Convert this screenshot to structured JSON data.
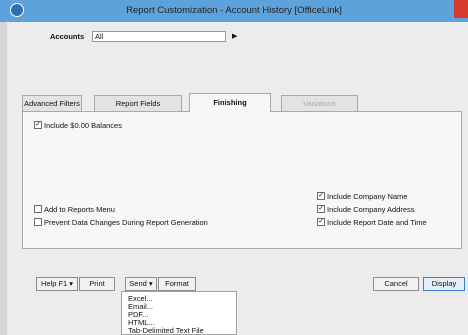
{
  "window": {
    "title": "Report Customization - Account History [OfficeLink]"
  },
  "accounts": {
    "label": "Accounts",
    "value": "All"
  },
  "tabs": [
    {
      "label": "Advanced Filters"
    },
    {
      "label": "Report Fields"
    },
    {
      "label": "Finishing"
    },
    {
      "label": "Variations"
    }
  ],
  "finishing": {
    "include_zero": {
      "label": "Include $0.00 Balances",
      "checked": true
    },
    "add_menu": {
      "label": "Add to Reports Menu",
      "checked": false
    },
    "prevent_changes": {
      "label": "Prevent Data Changes During Report Generation",
      "checked": false
    },
    "company_name": {
      "label": "Include Company Name",
      "checked": true
    },
    "company_address": {
      "label": "Include Company Address",
      "checked": true
    },
    "date_time": {
      "label": "Include Report Date and Time",
      "checked": true
    }
  },
  "buttons": {
    "help": "Help F1",
    "print": "Print",
    "send": "Send",
    "format": "Format",
    "cancel": "Cancel",
    "display": "Display"
  },
  "send_menu": [
    "Excel...",
    "Email...",
    "PDF...",
    "HTML...",
    "Tab-Delimited Text File"
  ]
}
